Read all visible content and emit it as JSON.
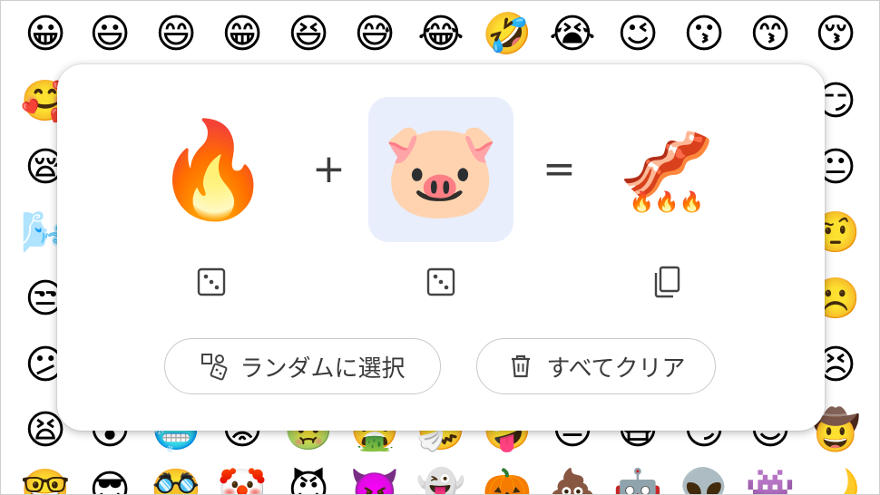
{
  "background_emojis": [
    "😀",
    "😃",
    "😄",
    "😁",
    "😆",
    "😅",
    "😂",
    "🤣",
    "😭",
    "😉",
    "😗",
    "😙",
    "😚",
    "🥰",
    "😏",
    "😪",
    "😐",
    "🌬️",
    "🤨",
    "😒",
    "☹️",
    "😕",
    "😣",
    "😫",
    "😵",
    "🥶",
    "😡",
    "🤢",
    "🤮",
    "🤧",
    "🤪",
    "😒",
    "😷",
    "😏",
    "😌",
    "🤠",
    "🤓",
    "😎",
    "🥸",
    "🤡",
    "😈",
    "👿",
    "👻",
    "🎃",
    "💩",
    "🤖",
    "👽",
    "👾",
    "🌙"
  ],
  "mixer": {
    "left_emoji": "🔥",
    "plus_symbol": "+",
    "right_emoji": "🐷",
    "equals_symbol": "=",
    "result_emoji": "🥓",
    "result_sub_emoji": "🔥🔥🔥"
  },
  "icons": {
    "left_dice": "dice-icon",
    "right_dice": "dice-icon",
    "copy": "copy-icon",
    "random": "shapes-dice-icon",
    "trash": "trash-icon"
  },
  "buttons": {
    "random_label": "ランダムに選択",
    "clear_label": "すべてクリア"
  },
  "colors": {
    "selected_slot_bg": "#e8eefc",
    "pill_border": "#c9c9c9",
    "icon_color": "#444444"
  }
}
